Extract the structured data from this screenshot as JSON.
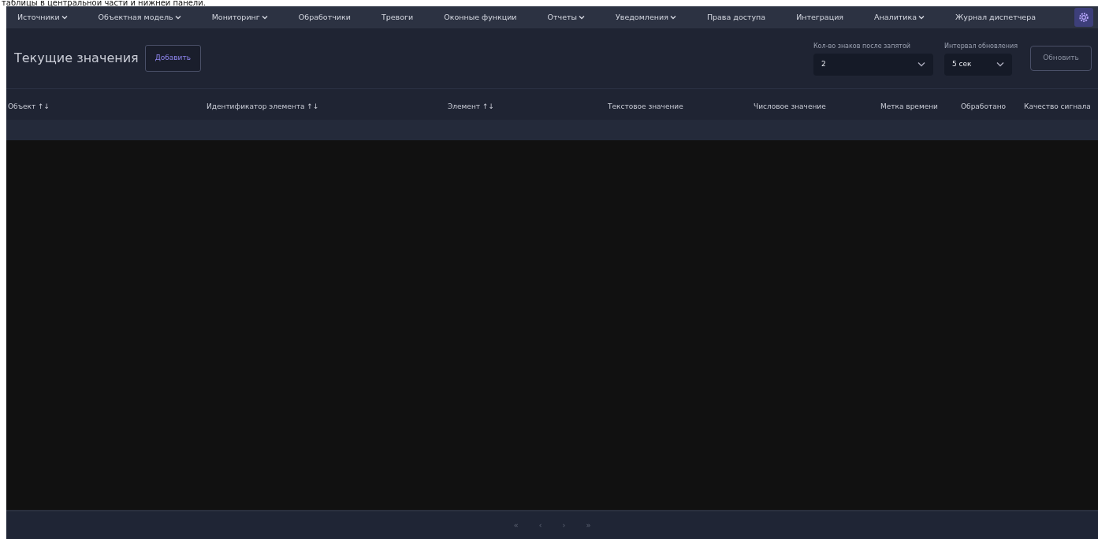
{
  "caption": "таблицы в центральной части и нижней панели.",
  "menu": [
    {
      "label": "Источники",
      "dropdown": true
    },
    {
      "label": "Объектная модель",
      "dropdown": true
    },
    {
      "label": "Мониторинг",
      "dropdown": true
    },
    {
      "label": "Обработчики",
      "dropdown": false
    },
    {
      "label": "Тревоги",
      "dropdown": false
    },
    {
      "label": "Оконные функции",
      "dropdown": false
    },
    {
      "label": "Отчеты",
      "dropdown": true
    },
    {
      "label": "Уведомления",
      "dropdown": true
    },
    {
      "label": "Права доступа",
      "dropdown": false
    },
    {
      "label": "Интеграция",
      "dropdown": false
    },
    {
      "label": "Аналитика",
      "dropdown": true
    },
    {
      "label": "Журнал диспетчера",
      "dropdown": false
    }
  ],
  "page_title": "Текущие значения",
  "add_button": "Добавить",
  "decimals": {
    "label": "Кол-во знаков после запятой",
    "value": "2"
  },
  "interval": {
    "label": "Интервал обновления",
    "value": "5 сек"
  },
  "refresh_button": "Обновить",
  "table": {
    "columns": [
      {
        "label": "Объект",
        "sort": "↑↓"
      },
      {
        "label": "Идентификатор элемента",
        "sort": "↑↓"
      },
      {
        "label": "Элемент",
        "sort": "↑↓"
      },
      {
        "label": "Текстовое значение"
      },
      {
        "label": "Числовое значение"
      },
      {
        "label": "Метка времени"
      },
      {
        "label": "Обработано"
      },
      {
        "label": "Качество сигнала"
      }
    ]
  },
  "pagination": [
    {
      "label": "«",
      "disabled": true
    },
    {
      "label": "‹",
      "disabled": true
    },
    {
      "label": "›",
      "disabled": true
    },
    {
      "label": "»",
      "disabled": true
    }
  ]
}
